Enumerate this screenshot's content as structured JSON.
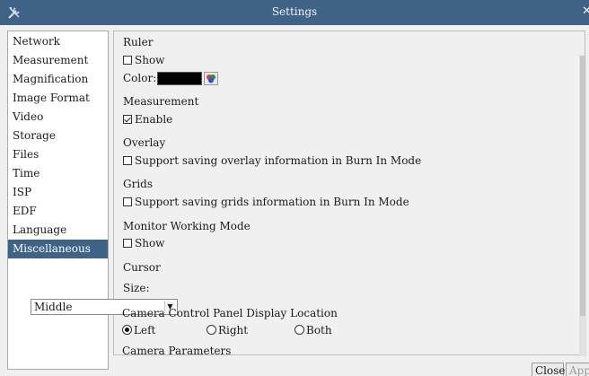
{
  "window": {
    "title": "Settings",
    "app_icon": "tools-icon",
    "close_icon": "close-icon"
  },
  "sidebar": {
    "items": [
      {
        "label": "Network"
      },
      {
        "label": "Measurement"
      },
      {
        "label": "Magnification"
      },
      {
        "label": "Image Format"
      },
      {
        "label": "Video"
      },
      {
        "label": "Storage"
      },
      {
        "label": "Files"
      },
      {
        "label": "Time"
      },
      {
        "label": "ISP"
      },
      {
        "label": "EDF"
      },
      {
        "label": "Language"
      },
      {
        "label": "Miscellaneous"
      }
    ],
    "selected": "Miscellaneous",
    "selected_color": "#3e6387"
  },
  "ruler": {
    "heading": "Ruler",
    "show_label": "Show",
    "show_checked": false,
    "color_label": "Color:",
    "color_value": "#000000"
  },
  "measurement": {
    "heading": "Measurement",
    "enable_label": "Enable",
    "enable_checked": true
  },
  "overlay": {
    "heading": "Overlay",
    "option_label": "Support saving overlay information in Burn In Mode",
    "option_checked": false
  },
  "grids": {
    "heading": "Grids",
    "option_label": "Support saving grids information in Burn In Mode",
    "option_checked": false
  },
  "monitor": {
    "heading": "Monitor Working Mode",
    "show_label": "Show",
    "show_checked": false
  },
  "cursor": {
    "heading": "Cursor",
    "size_label": "Size:",
    "size_value": "Middle"
  },
  "camera_panel": {
    "heading": "Camera Control Panel Display Location",
    "options": [
      "Left",
      "Right",
      "Both"
    ],
    "selected": "Left"
  },
  "camera_params": {
    "heading": "Camera Parameters"
  },
  "buttons": {
    "close": "Close",
    "apply": "Appl"
  }
}
